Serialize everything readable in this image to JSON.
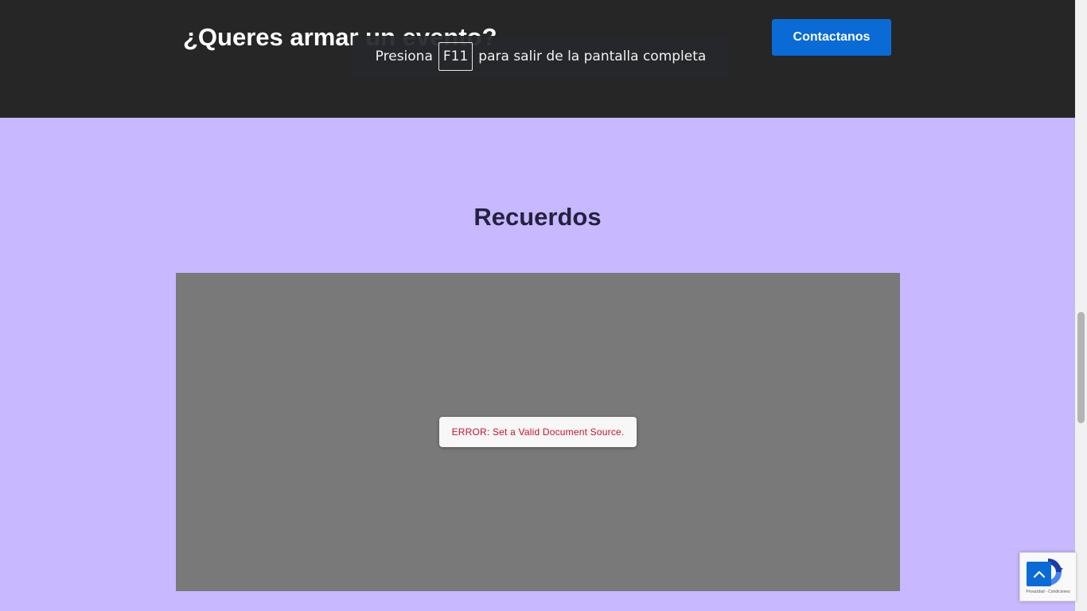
{
  "cta_band": {
    "heading": "¿Queres armar un evento?",
    "button_label": "Contactanos"
  },
  "fullscreen_notice": {
    "prefix": "Presiona",
    "key": "F11",
    "suffix": "para salir de la pantalla completa"
  },
  "gallery": {
    "title": "Recuerdos",
    "viewer_error": "ERROR: Set a Valid Document Source."
  },
  "recaptcha": {
    "footer": "Privacidad - Condiciones"
  },
  "icons": {
    "back_to_top": "chevron-up-icon",
    "recaptcha": "recaptcha-logo-icon"
  },
  "colors": {
    "band_background": "#262626",
    "page_background": "#c7b8ff",
    "button": "#0a6bd6",
    "title": "#24223f",
    "viewer_background": "#797979",
    "error_text": "#c8102e"
  }
}
